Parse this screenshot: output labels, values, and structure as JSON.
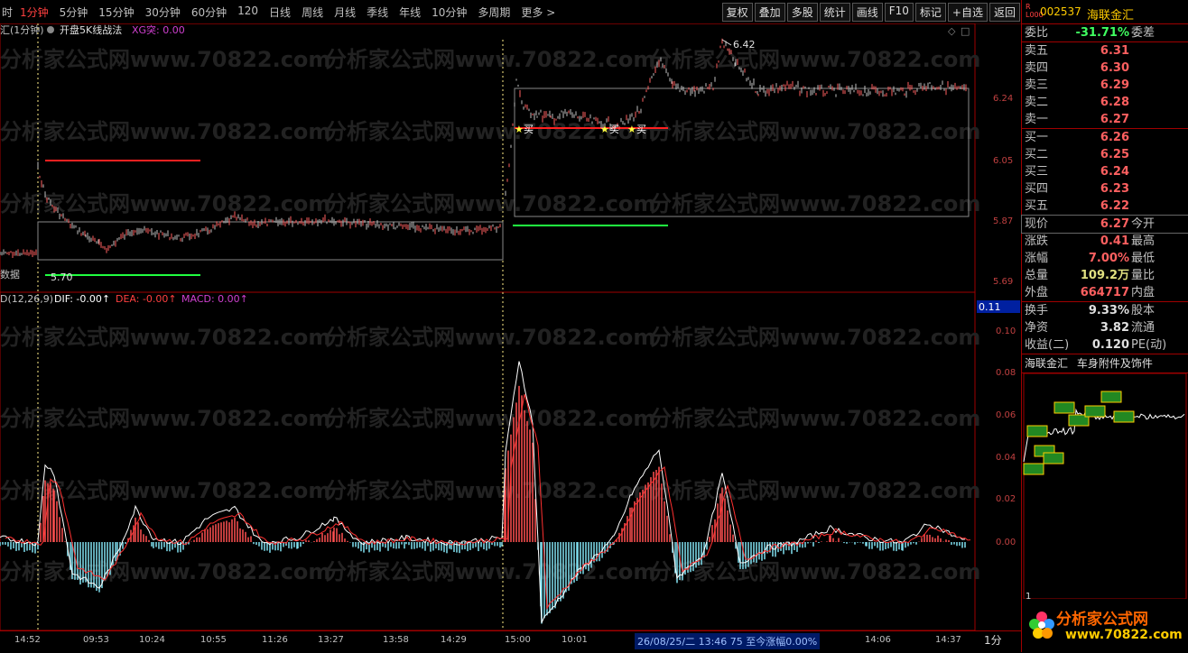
{
  "toolbar": {
    "periods": [
      "1分钟",
      "5分钟",
      "15分钟",
      "30分钟",
      "60分钟",
      "120",
      "日线",
      "周线",
      "月线",
      "季线",
      "年线",
      "10分钟",
      "多周期",
      "更多 >"
    ],
    "active_index": 0,
    "left_cut": "时",
    "right_buttons": [
      "复权",
      "叠加",
      "多股",
      "统计",
      "画线",
      "F10",
      "标记",
      "+自选",
      "返回"
    ]
  },
  "main_chart": {
    "title": "汇(1分钟)",
    "indicator": "开盘5K线战法",
    "xg_label": "XG突: 0.00",
    "y_ticks": [
      "6.24",
      "6.05",
      "5.87",
      "5.69"
    ],
    "high_label": "6.42",
    "low_label": "5.70",
    "buy_label": "买",
    "data_label": "数据"
  },
  "macd": {
    "title": "D(12,26,9)",
    "dif": "DIF: -0.00↑",
    "dea": "DEA: -0.00↑",
    "macd": "MACD: 0.00↑",
    "cursor_value": "0.11",
    "y_ticks": [
      "0.10",
      "0.08",
      "0.06",
      "0.04",
      "0.02",
      "0.00"
    ]
  },
  "time_axis": [
    "14:52",
    "09:53",
    "10:24",
    "10:55",
    "11:26",
    "13:27",
    "13:58",
    "14:29",
    "15:00",
    "10:01",
    "13:46",
    "14:06",
    "14:37"
  ],
  "status_text": "26/08/25/二 13:46 75 至今涨幅0.00%",
  "panel": {
    "code": "002537",
    "name": "海联金汇",
    "badge_r": "R",
    "badge_l": "L000",
    "weibi_label": "委比",
    "weibi_value": "-31.71%",
    "weicha_label": "委差",
    "asks": [
      {
        "label": "卖五",
        "price": "6.31"
      },
      {
        "label": "卖四",
        "price": "6.30"
      },
      {
        "label": "卖三",
        "price": "6.29"
      },
      {
        "label": "卖二",
        "price": "6.28"
      },
      {
        "label": "卖一",
        "price": "6.27"
      }
    ],
    "bids": [
      {
        "label": "买一",
        "price": "6.26"
      },
      {
        "label": "买二",
        "price": "6.25"
      },
      {
        "label": "买三",
        "price": "6.24"
      },
      {
        "label": "买四",
        "price": "6.23"
      },
      {
        "label": "买五",
        "price": "6.22"
      }
    ],
    "quote": [
      {
        "label": "现价",
        "value": "6.27",
        "label2": "今开"
      },
      {
        "label": "涨跌",
        "value": "0.41",
        "label2": "最高"
      },
      {
        "label": "涨幅",
        "value": "7.00%",
        "label2": "最低"
      },
      {
        "label": "总量",
        "value": "109.2万",
        "label2": "量比"
      },
      {
        "label": "外盘",
        "value": "664717",
        "label2": "内盘"
      }
    ],
    "stats": [
      {
        "label": "换手",
        "value": "9.33%",
        "label2": "股本"
      },
      {
        "label": "净资",
        "value": "3.82",
        "label2": "流通"
      },
      {
        "label": "收益(二)",
        "value": "0.120",
        "label2": "PE(动)"
      }
    ],
    "sector_name": "海联金汇",
    "sector_industry": "车身附件及饰件",
    "bottom_tick": "1",
    "bottom_cut": "1分"
  },
  "watermark": "分析家公式网www.70822.com",
  "logo": {
    "line1": "分析家公式网",
    "line2": "www.70822.com"
  }
}
